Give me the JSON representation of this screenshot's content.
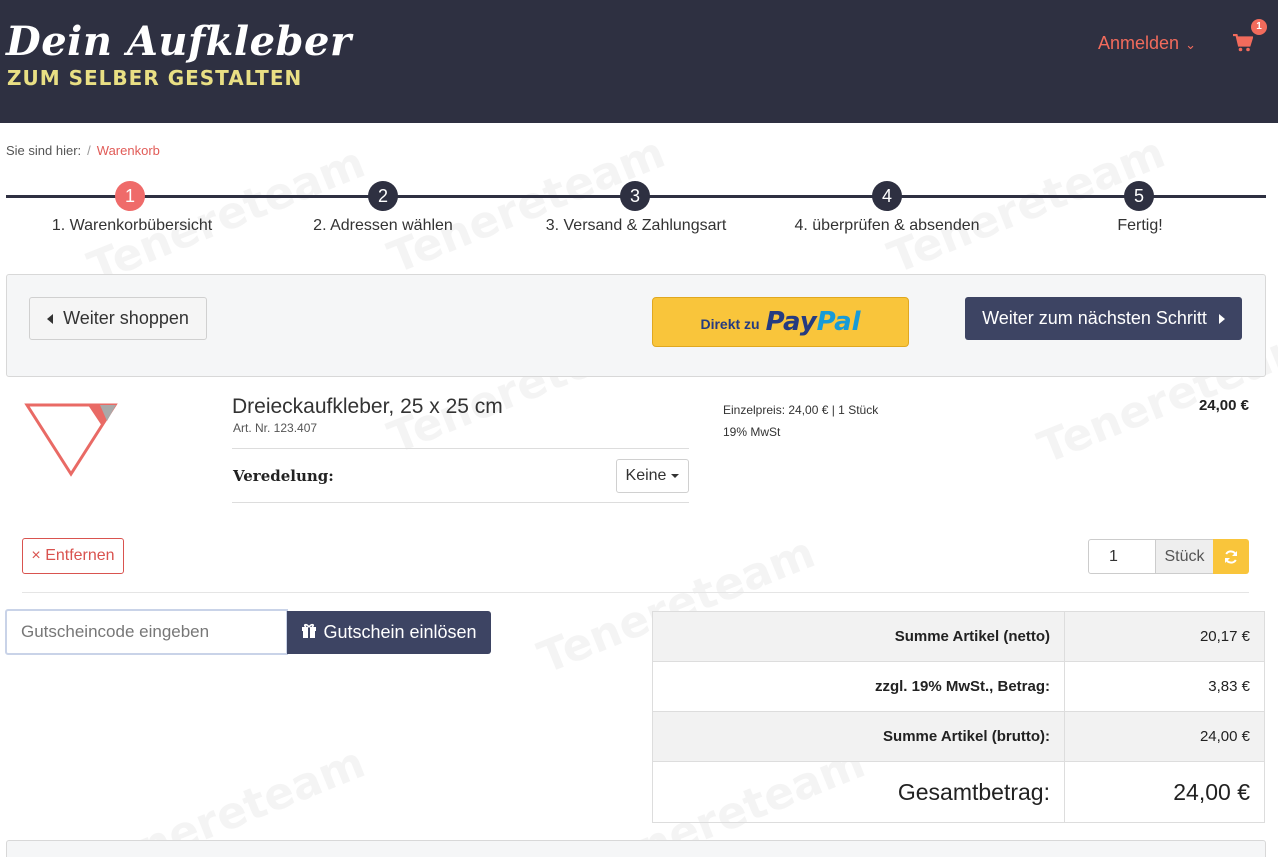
{
  "header": {
    "logo_line1": "Dein Aufkleber",
    "logo_line2": "ZUM SELBER GESTALTEN",
    "login_label": "Anmelden",
    "cart_count": "1"
  },
  "breadcrumb": {
    "prefix": "Sie sind hier:",
    "separator": "/",
    "current": "Warenkorb"
  },
  "steps": [
    {
      "number": "1",
      "label": "1. Warenkorbübersicht",
      "active": true
    },
    {
      "number": "2",
      "label": "2. Adressen wählen",
      "active": false
    },
    {
      "number": "3",
      "label": "3. Versand & Zahlungsart",
      "active": false
    },
    {
      "number": "4",
      "label": "4. überprüfen & absenden",
      "active": false
    },
    {
      "number": "5",
      "label": "Fertig!",
      "active": false
    }
  ],
  "actions": {
    "continue_shopping": "Weiter shoppen",
    "paypal_prefix": "Direkt zu",
    "paypal_pay": "Pay",
    "paypal_pal": "Pal",
    "next_step": "Weiter zum nächsten Schritt"
  },
  "product": {
    "title": "Dreieckaufkleber, 25 x 25 cm",
    "article_number": "Art. Nr. 123.407",
    "finishing_label": "Veredelung:",
    "finishing_value": "Keine",
    "unit_price_text": "Einzelpreis: 24,00 € | 1 Stück",
    "vat_text": "19% MwSt",
    "total_price": "24,00 €",
    "remove_label": "× Entfernen",
    "quantity": "1",
    "quantity_unit": "Stück"
  },
  "coupon": {
    "placeholder": "Gutscheincode eingeben",
    "button_label": "Gutschein einlösen"
  },
  "totals": [
    {
      "label": "Summe Artikel (netto)",
      "value": "20,17 €"
    },
    {
      "label": "zzgl. 19% MwSt., Betrag:",
      "value": "3,83 €"
    },
    {
      "label": "Summe Artikel (brutto):",
      "value": "24,00 €"
    },
    {
      "label": "Gesamtbetrag:",
      "value": "24,00 €"
    }
  ],
  "colors": {
    "header_bg": "#2e3041",
    "accent_red": "#ef6b6a",
    "button_dark": "#3d4463",
    "paypal_yellow": "#f9c53b"
  },
  "watermark": "Tenereteam"
}
